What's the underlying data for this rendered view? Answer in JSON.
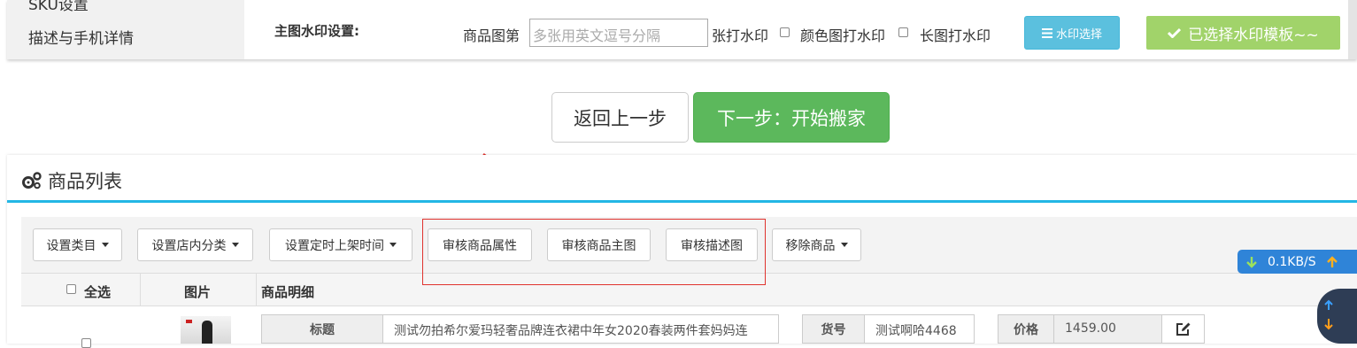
{
  "side_nav": {
    "items": [
      "SKU设置",
      "描述与手机详情"
    ]
  },
  "watermark": {
    "section_label": "主图水印设置:",
    "image_no_label": "商品图第",
    "image_no_placeholder": "多张用英文逗号分隔",
    "image_no_suffix": "张打水印",
    "color_image_label": "颜色图打水印",
    "long_image_label": "长图打水印",
    "select_button": "水印选择",
    "selected_button": "已选择水印模板~~"
  },
  "nav": {
    "back": "返回上一步",
    "next": "下一步：开始搬家"
  },
  "product_list": {
    "title": "商品列表",
    "toolbar": {
      "set_category": "设置类目",
      "set_store_category": "设置店内分类",
      "set_schedule": "设置定时上架时间",
      "review_attributes": "审核商品属性",
      "review_main_image": "审核商品主图",
      "review_description": "审核描述图",
      "remove": "移除商品"
    },
    "columns": {
      "select_all": "全选",
      "image": "图片",
      "detail": "商品明细"
    },
    "row": {
      "title_label": "标题",
      "title_value": "测试勿拍希尔爱玛轻奢品牌连衣裙中年女2020春装两件套妈妈连",
      "sku_label": "货号",
      "sku_value": "测试啊哈4468",
      "price_label": "价格",
      "price_value": "1459.00"
    }
  },
  "speed_widget": {
    "value": "0.1KB/S"
  },
  "colors": {
    "accent_blue": "#23b7e5",
    "success_green": "#5cb85c",
    "info_blue": "#5bc0de",
    "highlight_red": "#e0332e"
  }
}
